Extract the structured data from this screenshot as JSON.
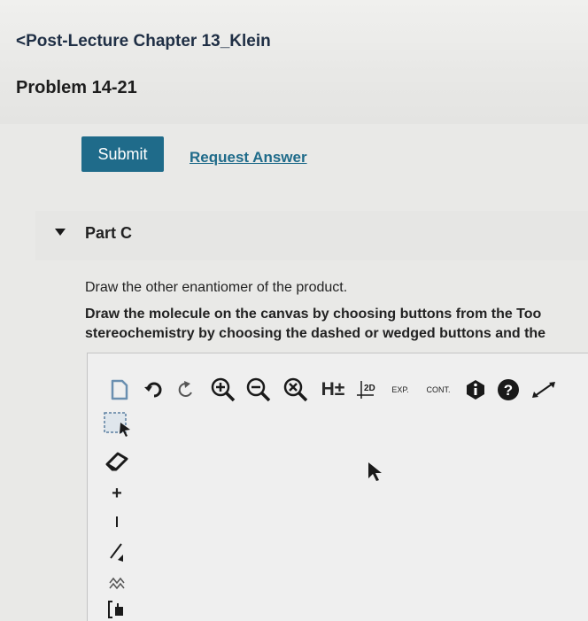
{
  "header": {
    "back_link": "<Post-Lecture Chapter 13_Klein",
    "problem_title": "Problem 14-21"
  },
  "actions": {
    "submit_label": "Submit",
    "request_answer_label": "Request Answer"
  },
  "part": {
    "label": "Part C",
    "instruction1": "Draw the other enantiomer of the product.",
    "instruction2_line1": "Draw the molecule on the canvas by choosing buttons from the Too",
    "instruction2_line2": "stereochemistry by choosing the dashed or wedged buttons and the"
  },
  "toolbar": {
    "h_label": "H±",
    "twod_label": "2D",
    "exp_label": "EXP.",
    "cont_label": "CONT.",
    "icons": [
      "new-document-icon",
      "undo-icon",
      "redo-icon",
      "zoom-in-icon",
      "zoom-out-icon",
      "clear-icon",
      "h-plus-minus-icon",
      "2d-icon",
      "expand-icon",
      "contract-icon",
      "info-icon",
      "help-icon",
      "fullscreen-icon"
    ]
  },
  "left_tools": {
    "icons": [
      "select-icon",
      "eraser-icon",
      "plus-charge-icon",
      "minus-charge-icon",
      "bond-icon",
      "chain-icon",
      "bracket-icon"
    ]
  },
  "colors": {
    "accent": "#1f6b8a",
    "header_text": "#1f2f45"
  }
}
